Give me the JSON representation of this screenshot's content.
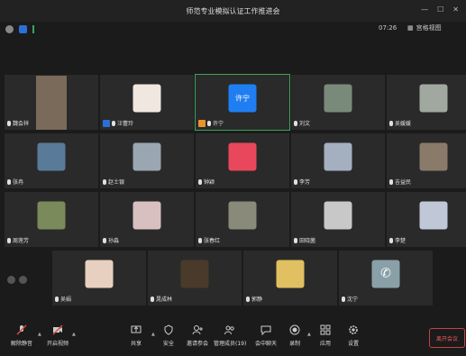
{
  "window": {
    "title": "师范专业模拟认证工作推进会"
  },
  "status": {
    "time": "07:26",
    "view_label": "宫格视图"
  },
  "participants": [
    {
      "name": "魏会祥",
      "icon": "person-photo",
      "color": "#7a6a5a",
      "active": false,
      "muted": false
    },
    {
      "name": "汪蕾玲",
      "icon": "logo-20",
      "color": "#f0e7e0",
      "active": false,
      "muted": false
    },
    {
      "name": "许宁",
      "icon": "avatar-text",
      "color": "#1f7ef2",
      "avatar_text": "许宁",
      "active": true,
      "muted": false
    },
    {
      "name": "刘文",
      "icon": "landscape-photo",
      "color": "#7a8a7a",
      "active": false,
      "muted": false
    },
    {
      "name": "吴媛媛",
      "icon": "landscape-photo",
      "color": "#a0a8a0",
      "active": false,
      "muted": false
    },
    {
      "name": "张冉",
      "icon": "landscape-photo",
      "color": "#5a7a9a",
      "active": false,
      "muted": false
    },
    {
      "name": "赵士银",
      "icon": "landscape-photo",
      "color": "#9aa6b2",
      "active": false,
      "muted": false
    },
    {
      "name": "钟颖",
      "icon": "cartoon-avatar",
      "color": "#e9475c",
      "active": false,
      "muted": false
    },
    {
      "name": "李芳",
      "icon": "landscape-photo",
      "color": "#a4b0c0",
      "active": false,
      "muted": false
    },
    {
      "name": "吉益民",
      "icon": "person-photo",
      "color": "#8a7a6a",
      "active": false,
      "muted": false
    },
    {
      "name": "周莲芳",
      "icon": "person-photo",
      "color": "#7a8a5a",
      "active": false,
      "muted": false
    },
    {
      "name": "孙淼",
      "icon": "cartoon-avatar",
      "color": "#d8c0c0",
      "active": false,
      "muted": false
    },
    {
      "name": "张春红",
      "icon": "landscape-photo",
      "color": "#8a8a7a",
      "active": false,
      "muted": false
    },
    {
      "name": "田晓菌",
      "icon": "person-photo",
      "color": "#c8c8c8",
      "active": false,
      "muted": false
    },
    {
      "name": "李楚",
      "icon": "cartoon-avatar",
      "color": "#c0c8d8",
      "active": false,
      "muted": false
    },
    {
      "name": "吴娟",
      "icon": "cartoon-avatar",
      "color": "#e8d0c0",
      "active": false,
      "muted": false
    },
    {
      "name": "晁成林",
      "icon": "landscape-photo",
      "color": "#4a3a2a",
      "active": false,
      "muted": false
    },
    {
      "name": "郭静",
      "icon": "cartoon-avatar",
      "color": "#e0c060",
      "active": false,
      "muted": false
    },
    {
      "name": "沈宁",
      "icon": "phone-icon",
      "color": "#8aa0a8",
      "active": false,
      "muted": false
    }
  ],
  "toolbar": {
    "mute_label": "解除静音",
    "video_label": "开启视频",
    "share_label": "共享",
    "security_label": "安全",
    "invite_label": "邀请参会",
    "manage_label": "管理成员(19)",
    "chat_label": "会中聊天",
    "record_label": "录制",
    "apps_label": "应用",
    "settings_label": "设置",
    "leave_label": "离开会议"
  },
  "colors": {
    "background": "#1b1b1b",
    "tile": "#2a2a2a",
    "active_border": "#3aa35a",
    "leave": "#c94040",
    "accent": "#1f7ef2"
  }
}
